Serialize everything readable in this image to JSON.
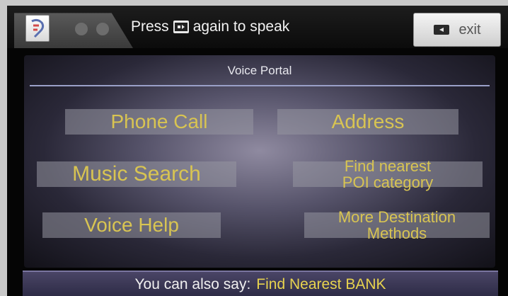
{
  "header": {
    "prompt_before": "Press",
    "prompt_after": "again to speak",
    "talk_key_icon": "talk-button-icon",
    "exit_label": "exit",
    "exit_icon": "back-icon"
  },
  "panel": {
    "title": "Voice Portal",
    "options": [
      {
        "lines": [
          "Phone Call"
        ]
      },
      {
        "lines": [
          "Address"
        ]
      },
      {
        "lines": [
          "Music Search"
        ]
      },
      {
        "lines": [
          "Find nearest",
          "POI category"
        ]
      },
      {
        "lines": [
          "Voice Help"
        ]
      },
      {
        "lines": [
          "More Destination",
          "Methods"
        ]
      }
    ]
  },
  "footer": {
    "prefix": "You can also say:",
    "example": "Find Nearest BANK"
  },
  "colors": {
    "option_text": "#d8c452",
    "hint_example": "#e8d34e",
    "panel_rule": "#9aa0c8"
  }
}
